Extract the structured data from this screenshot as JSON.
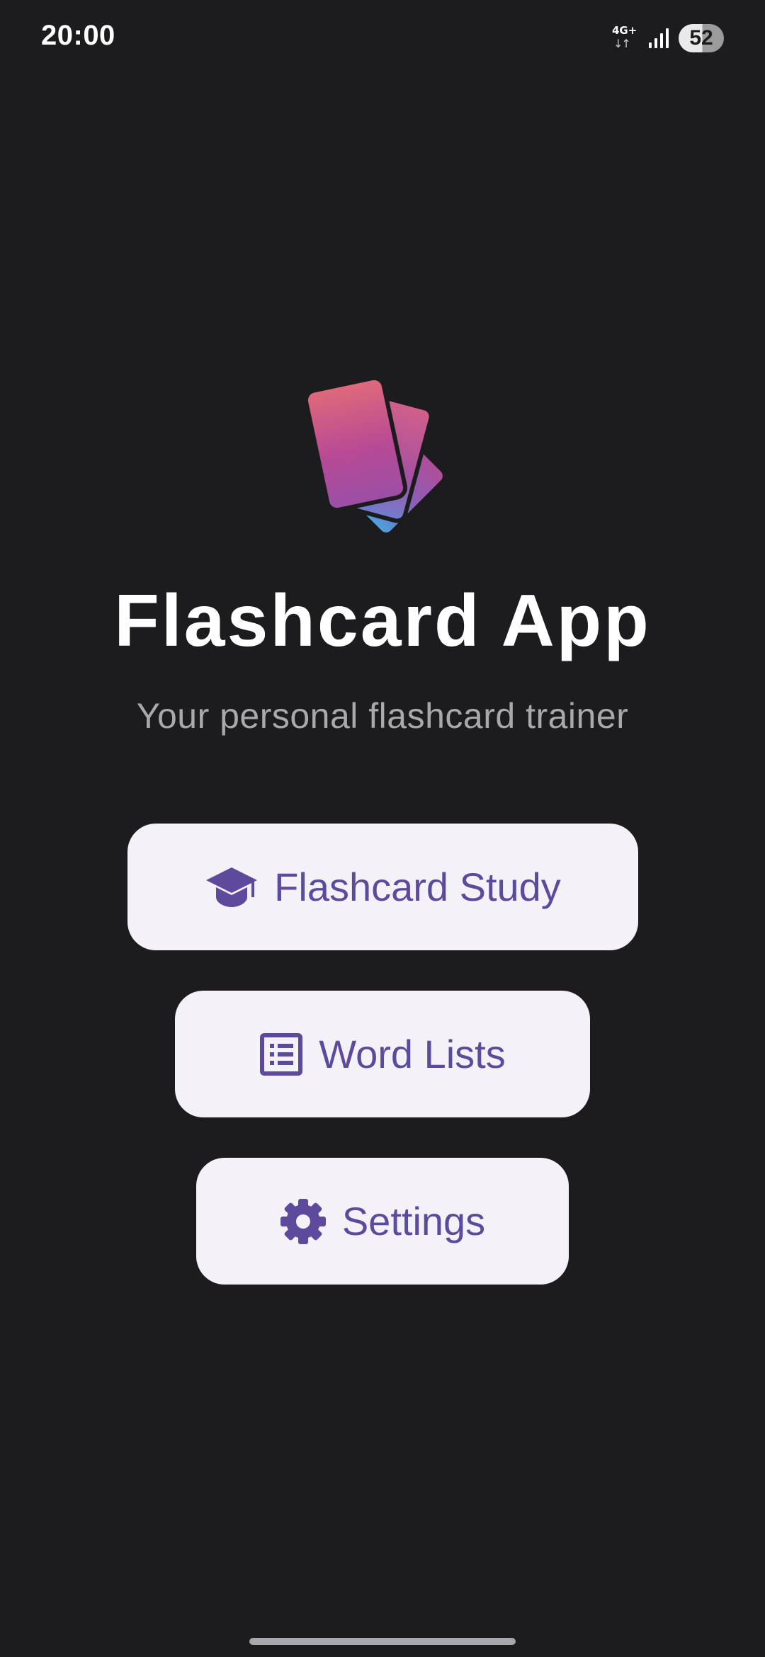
{
  "status_bar": {
    "time": "20:00",
    "network_label": "4G+",
    "network_arrows": "↓↑",
    "battery_level": "52",
    "icons": [
      "network-4g-icon",
      "signal-icon",
      "battery-icon"
    ]
  },
  "app": {
    "title": "Flashcard App",
    "subtitle": "Your personal flashcard trainer",
    "logo_icon": "flashcards-logo-icon"
  },
  "menu": {
    "items": [
      {
        "label": "Flashcard Study",
        "icon": "graduation-cap-icon"
      },
      {
        "label": "Word Lists",
        "icon": "list-icon"
      },
      {
        "label": "Settings",
        "icon": "gear-icon"
      }
    ]
  },
  "colors": {
    "background": "#1c1c1e",
    "button_background": "#f4f1f9",
    "accent": "#5d4a9c",
    "title": "#ffffff",
    "subtitle": "#a8a8ad",
    "logo_gradient_top": "#e06a7a",
    "logo_gradient_mid": "#b24c98",
    "logo_gradient_bottom": "#4aa3e0"
  }
}
